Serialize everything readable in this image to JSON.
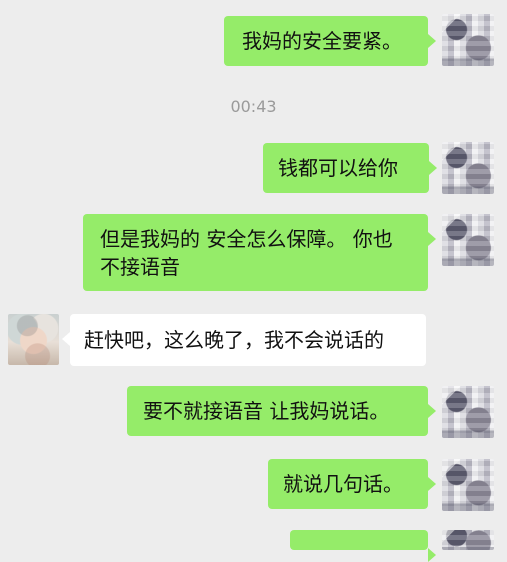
{
  "app": {
    "background": "#ededed"
  },
  "timestamp": "00:43",
  "messages": [
    {
      "sender": "self",
      "text": "我妈的安全要紧。"
    },
    {
      "sender": "self",
      "text": "钱都可以给你"
    },
    {
      "sender": "self",
      "text": "但是我妈的 安全怎么保障。 你也\n不接语音"
    },
    {
      "sender": "other",
      "text": "赶快吧，这么晚了，我不会说话的"
    },
    {
      "sender": "self",
      "text": "要不就接语音 让我妈说话。"
    },
    {
      "sender": "self",
      "text": "就说几句话。"
    }
  ],
  "colors": {
    "self_bubble": "#95ec69",
    "other_bubble": "#ffffff",
    "timestamp_text": "#9a9a9a"
  }
}
